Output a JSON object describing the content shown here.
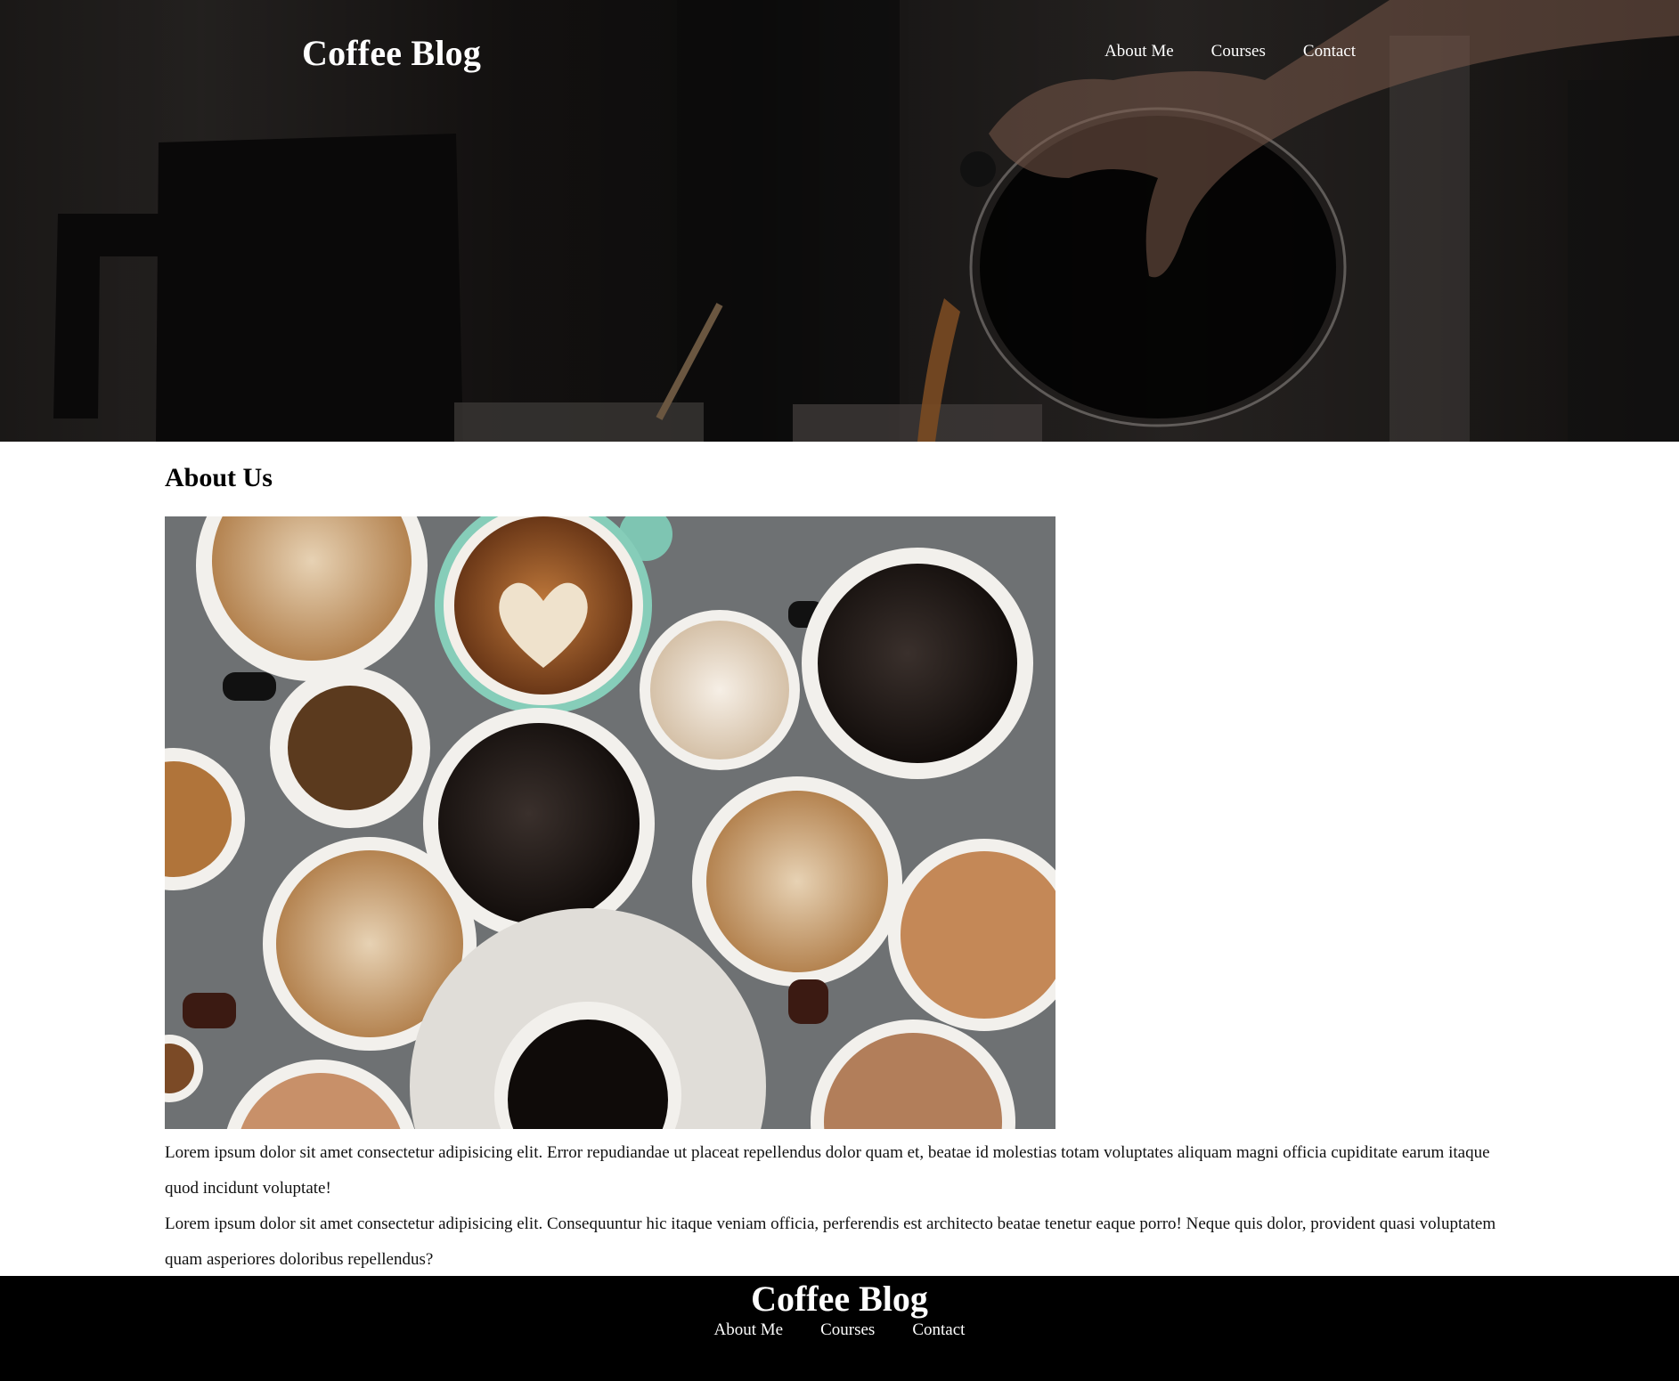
{
  "header": {
    "site_title": "Coffee Blog",
    "nav": [
      "About Me",
      "Courses",
      "Contact"
    ]
  },
  "about": {
    "heading": "About Us",
    "paragraphs": [
      "Lorem ipsum dolor sit amet consectetur adipisicing elit. Error repudiandae ut placeat repellendus dolor quam et, beatae id molestias totam voluptates aliquam magni officia cupiditate earum itaque quod incidunt voluptate!",
      "Lorem ipsum dolor sit amet consectetur adipisicing elit. Consequuntur hic itaque veniam officia, perferendis est architecto beatae tenetur eaque porro! Neque quis dolor, provident quasi voluptatem quam asperiores doloribus repellendus?"
    ]
  },
  "footer": {
    "site_title": "Coffee Blog",
    "nav": [
      "About Me",
      "Courses",
      "Contact"
    ]
  },
  "colors": {
    "footer_bg": "#000000",
    "hero_text": "#ffffff",
    "body_text": "#111111"
  }
}
